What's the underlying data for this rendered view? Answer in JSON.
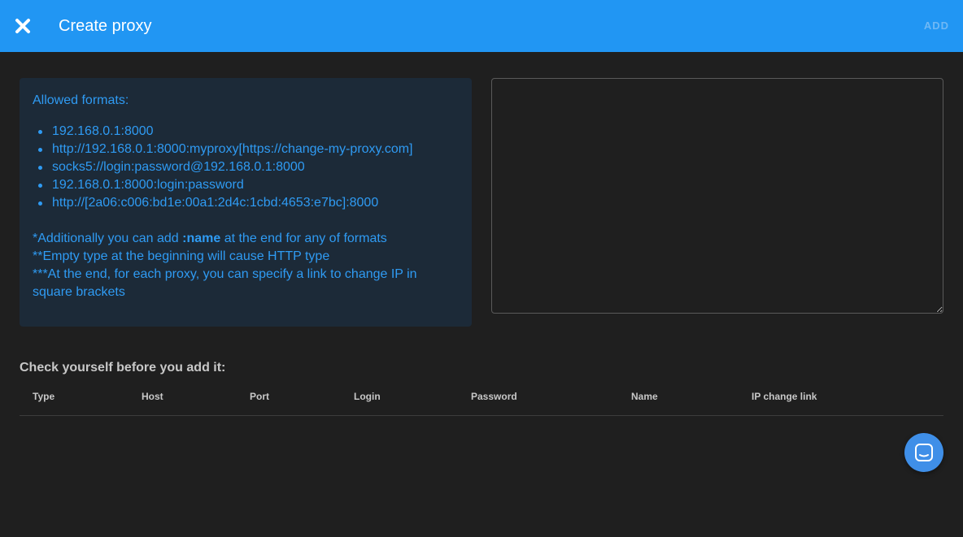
{
  "header": {
    "title": "Create proxy",
    "add_label": "ADD",
    "close_icon": "close-icon"
  },
  "info": {
    "heading": "Allowed formats:",
    "formats": [
      "192.168.0.1:8000",
      "http://192.168.0.1:8000:myproxy[https://change-my-proxy.com]",
      "socks5://login:password@192.168.0.1:8000",
      "192.168.0.1:8000:login:password",
      "http://[2a06:c006:bd1e:00a1:2d4c:1cbd:4653:e7bc]:8000"
    ],
    "note1_prefix": "*Additionally you can add ",
    "note1_bold": ":name",
    "note1_suffix": " at the end for any of formats",
    "note2": "**Empty type at the beginning will cause HTTP type",
    "note3": "***At the end, for each proxy, you can specify a link to change IP in square brackets"
  },
  "proxy_input": {
    "value": "",
    "placeholder": ""
  },
  "preview": {
    "title": "Check yourself before you add it:",
    "columns": [
      "Type",
      "Host",
      "Port",
      "Login",
      "Password",
      "Name",
      "IP change link"
    ]
  },
  "chat_button": {
    "icon": "chat-icon"
  },
  "colors": {
    "header_bg": "#2196f3",
    "page_bg": "#1f1f1f",
    "info_bg": "#1c2a38",
    "info_text": "#2f9bf3",
    "fab_bg": "#3f8fe8"
  }
}
